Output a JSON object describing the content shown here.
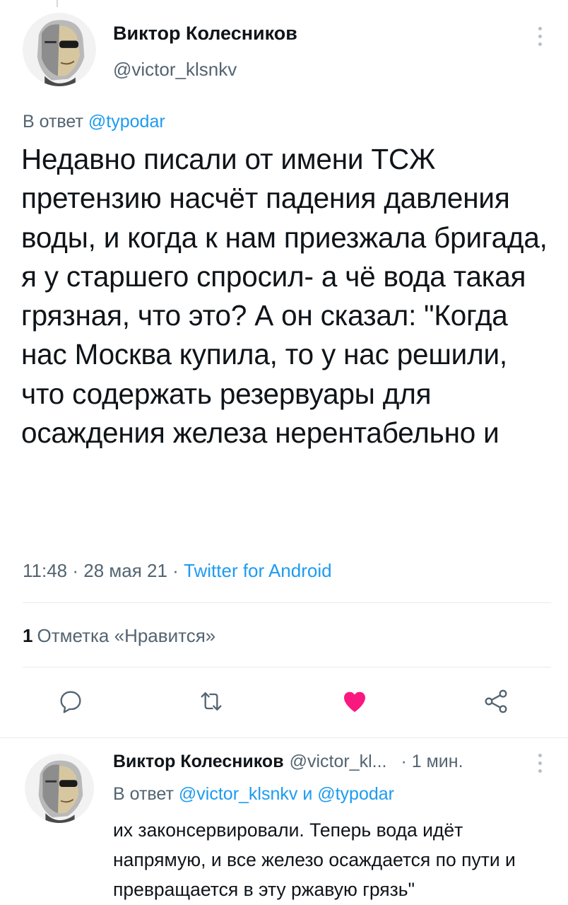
{
  "main_tweet": {
    "author_name": "Виктор Колесников",
    "author_handle": "@victor_klsnkv",
    "reply_to_prefix": "В ответ ",
    "reply_to_mention": "@typodar",
    "text": "Недавно писали от имени ТСЖ претензию насчёт падения давления воды, и когда к нам приезжала бригада, я у старшего спросил- а чё вода такая грязная, что это? А он сказал: \"Когда нас Москва купила, то у нас решили, что содержать резервуары для осаждения железа нерентабельно и",
    "timestamp": "11:48 · 28 мая 21 · ",
    "source_app": "Twitter for Android",
    "likes_count": "1",
    "likes_label": "Отметка «Нравится»",
    "liked": true,
    "actions": [
      "reply-icon",
      "retweet-icon",
      "heart-icon",
      "share-icon"
    ]
  },
  "reply_tweet": {
    "author_name": "Виктор Колесников",
    "author_handle": "@victor_kl...",
    "time": "· 1 мин.",
    "reply_to_prefix": "В ответ ",
    "reply_to_mentions": "@victor_klsnkv и @typodar",
    "text": "их законсервировали. Теперь вода идёт напрямую, и все железо осаждается по пути и превращается в эту ржавую грязь\""
  },
  "colors": {
    "text": "#0f1419",
    "secondary": "#536471",
    "link": "#1d9bf0",
    "like": "#f91880",
    "divider": "#e6ecf0"
  }
}
